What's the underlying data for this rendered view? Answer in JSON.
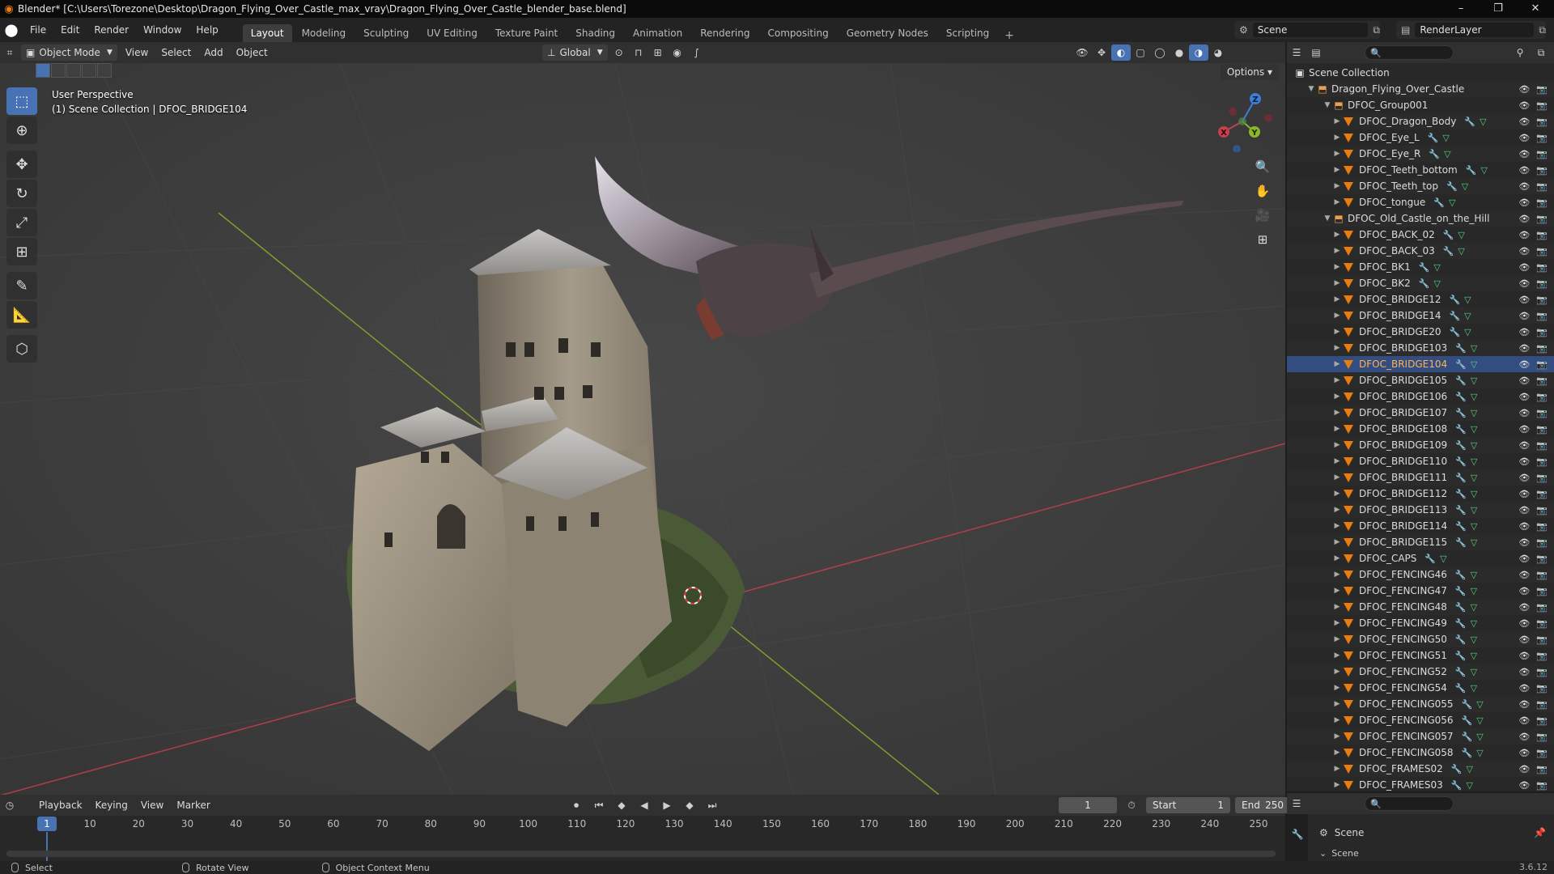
{
  "titlebar": {
    "app_icon": "blender-logo-icon",
    "title": "Blender* [C:\\Users\\Torezone\\Desktop\\Dragon_Flying_Over_Castle_max_vray\\Dragon_Flying_Over_Castle_blender_base.blend]",
    "minimize": "–",
    "maximize": "❐",
    "close": "✕"
  },
  "menubar": {
    "menus": [
      "File",
      "Edit",
      "Render",
      "Window",
      "Help"
    ],
    "workspaces": [
      "Layout",
      "Modeling",
      "Sculpting",
      "UV Editing",
      "Texture Paint",
      "Shading",
      "Animation",
      "Rendering",
      "Compositing",
      "Geometry Nodes",
      "Scripting"
    ],
    "active_workspace": "Layout",
    "add_workspace": "+",
    "scene": "Scene",
    "render_layer": "RenderLayer"
  },
  "viewport_header": {
    "mode": "Object Mode",
    "menus": [
      "View",
      "Select",
      "Add",
      "Object"
    ],
    "orientation": "Global",
    "options": "Options"
  },
  "viewport": {
    "perspective_label": "User Perspective",
    "context_label": "(1) Scene Collection | DFOC_BRIDGE104",
    "gizmo_axes": {
      "x": "X",
      "y": "Y",
      "z": "Z"
    },
    "colors": {
      "x_axis": "#c4404d",
      "y_axis": "#8bb72c",
      "z_axis": "#3d7dd6",
      "active": "#4772b3"
    }
  },
  "timeline": {
    "menus": [
      "Playback",
      "Keying",
      "View",
      "Marker"
    ],
    "current_frame": "1",
    "start_label": "Start",
    "start_value": "1",
    "end_label": "End",
    "end_value": "250",
    "ruler_current": "1",
    "ruler_ticks": [
      "10",
      "20",
      "30",
      "40",
      "50",
      "60",
      "70",
      "80",
      "90",
      "100",
      "110",
      "120",
      "130",
      "140",
      "150",
      "160",
      "170",
      "180",
      "190",
      "200",
      "210",
      "220",
      "230",
      "240",
      "250"
    ]
  },
  "statusbar": {
    "select": "Select",
    "rotate": "Rotate View",
    "context_menu": "Object Context Menu",
    "version": "3.6.12"
  },
  "outliner": {
    "rows": [
      {
        "label": "Scene Collection",
        "type": "scene"
      },
      {
        "label": "Dragon_Flying_Over_Castle",
        "type": "collection"
      },
      {
        "label": "DFOC_Group001",
        "type": "collection"
      },
      {
        "label": "DFOC_Dragon_Body",
        "type": "object"
      },
      {
        "label": "DFOC_Eye_L",
        "type": "object"
      },
      {
        "label": "DFOC_Eye_R",
        "type": "object"
      },
      {
        "label": "DFOC_Teeth_bottom",
        "type": "object"
      },
      {
        "label": "DFOC_Teeth_top",
        "type": "object"
      },
      {
        "label": "DFOC_tongue",
        "type": "object"
      },
      {
        "label": "DFOC_Old_Castle_on_the_Hill",
        "type": "collection"
      },
      {
        "label": "DFOC_BACK_02",
        "type": "object"
      },
      {
        "label": "DFOC_BACK_03",
        "type": "object"
      },
      {
        "label": "DFOC_BK1",
        "type": "object"
      },
      {
        "label": "DFOC_BK2",
        "type": "object"
      },
      {
        "label": "DFOC_BRIDGE12",
        "type": "object"
      },
      {
        "label": "DFOC_BRIDGE14",
        "type": "object"
      },
      {
        "label": "DFOC_BRIDGE20",
        "type": "object"
      },
      {
        "label": "DFOC_BRIDGE103",
        "type": "object"
      },
      {
        "label": "DFOC_BRIDGE104",
        "type": "object",
        "active": true
      },
      {
        "label": "DFOC_BRIDGE105",
        "type": "object"
      },
      {
        "label": "DFOC_BRIDGE106",
        "type": "object"
      },
      {
        "label": "DFOC_BRIDGE107",
        "type": "object"
      },
      {
        "label": "DFOC_BRIDGE108",
        "type": "object"
      },
      {
        "label": "DFOC_BRIDGE109",
        "type": "object"
      },
      {
        "label": "DFOC_BRIDGE110",
        "type": "object"
      },
      {
        "label": "DFOC_BRIDGE111",
        "type": "object"
      },
      {
        "label": "DFOC_BRIDGE112",
        "type": "object"
      },
      {
        "label": "DFOC_BRIDGE113",
        "type": "object"
      },
      {
        "label": "DFOC_BRIDGE114",
        "type": "object"
      },
      {
        "label": "DFOC_BRIDGE115",
        "type": "object"
      },
      {
        "label": "DFOC_CAPS",
        "type": "object"
      },
      {
        "label": "DFOC_FENCING46",
        "type": "object"
      },
      {
        "label": "DFOC_FENCING47",
        "type": "object"
      },
      {
        "label": "DFOC_FENCING48",
        "type": "object"
      },
      {
        "label": "DFOC_FENCING49",
        "type": "object"
      },
      {
        "label": "DFOC_FENCING50",
        "type": "object"
      },
      {
        "label": "DFOC_FENCING51",
        "type": "object"
      },
      {
        "label": "DFOC_FENCING52",
        "type": "object"
      },
      {
        "label": "DFOC_FENCING54",
        "type": "object"
      },
      {
        "label": "DFOC_FENCING055",
        "type": "object"
      },
      {
        "label": "DFOC_FENCING056",
        "type": "object"
      },
      {
        "label": "DFOC_FENCING057",
        "type": "object"
      },
      {
        "label": "DFOC_FENCING058",
        "type": "object"
      },
      {
        "label": "DFOC_FRAMES02",
        "type": "object"
      },
      {
        "label": "DFOC_FRAMES03",
        "type": "object"
      }
    ]
  },
  "properties": {
    "scene_label": "Scene",
    "panel_label": "Scene"
  }
}
